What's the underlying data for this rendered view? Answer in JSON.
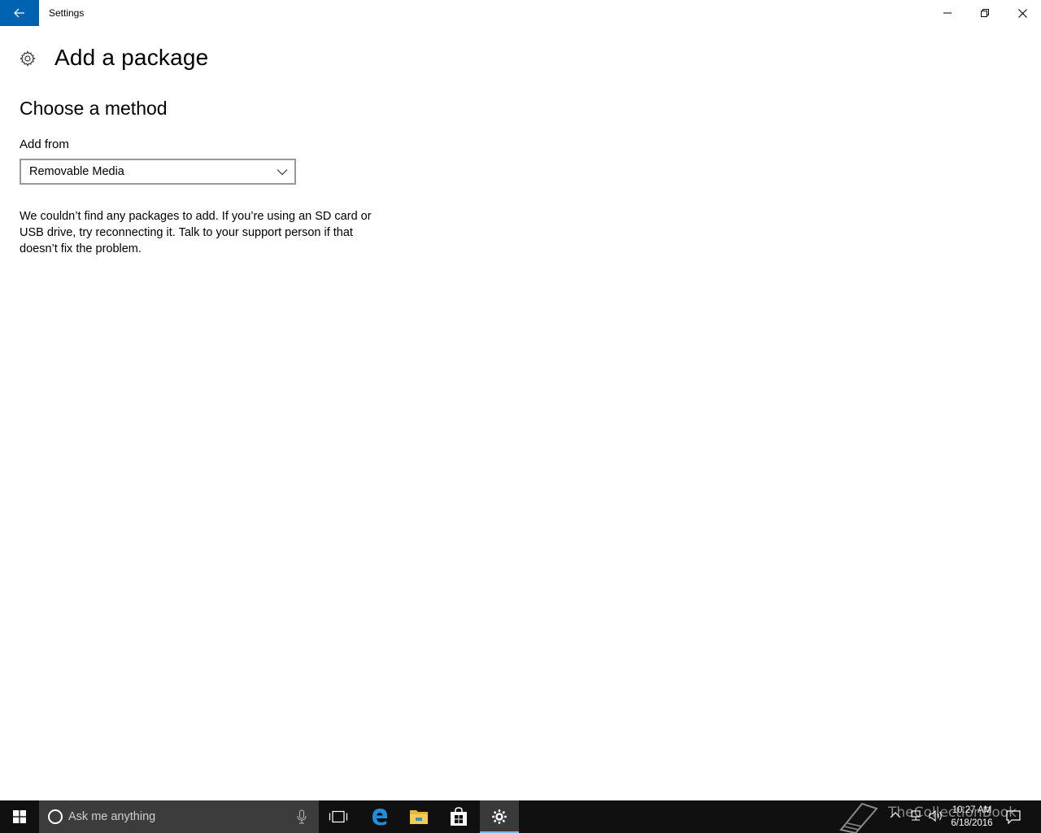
{
  "window": {
    "title": "Settings"
  },
  "page": {
    "title": "Add a package",
    "section_title": "Choose a method",
    "add_from_label": "Add from",
    "add_from_selected": "Removable Media",
    "message": "We couldn’t find any packages to add. If you’re using an SD card or USB drive, try reconnecting it. Talk to your support person if that doesn’t fix the problem."
  },
  "taskbar": {
    "search_placeholder": "Ask me anything",
    "clock_time": "10:27 AM",
    "clock_date": "6/18/2016",
    "watermark": "TheCollectionBook"
  },
  "icons": {
    "back": "back-arrow-icon",
    "minimize": "minimize-icon",
    "maximize": "restore-icon",
    "close": "close-icon",
    "header": "gear-icon",
    "dropdown": "chevron-down-icon",
    "start": "windows-logo-icon",
    "cortana": "cortana-circle-icon",
    "mic": "microphone-icon",
    "taskview": "task-view-icon",
    "edge": "edge-icon",
    "explorer": "folder-icon",
    "store": "store-icon",
    "settings": "gear-icon"
  },
  "colors": {
    "accent": "#0063b1",
    "taskbar": "#101010",
    "search_box": "#3c3c3c",
    "active_indicator": "#76b9ed"
  }
}
